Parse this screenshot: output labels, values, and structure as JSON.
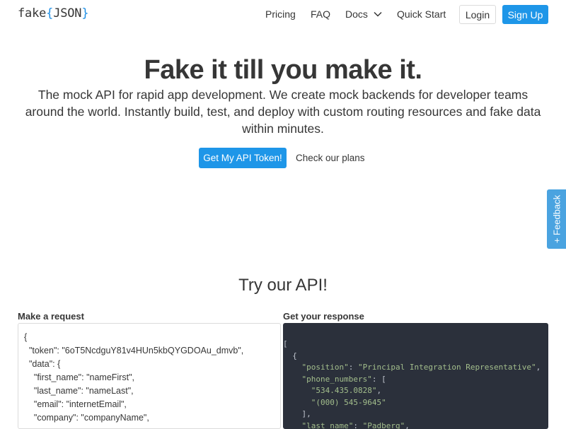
{
  "nav": {
    "logo_prefix": "fake",
    "logo_open": "{",
    "logo_word": "JSON",
    "logo_close": "}",
    "links": [
      "Pricing",
      "FAQ",
      "Docs",
      "Quick Start"
    ],
    "login_label": "Login",
    "signup_label": "Sign Up"
  },
  "hero": {
    "title": "Fake it till you make it.",
    "subtitle": "The mock API for rapid app development. We create mock backends for developer teams around the world. Instantly build, test, and deploy with custom routing resources and fake data within minutes.",
    "primary_cta": "Get My API Token!",
    "secondary_cta": "Check our plans"
  },
  "feedback": {
    "label": "+ Feedback"
  },
  "try_api": {
    "title": "Try our API!",
    "request_label": "Make a request",
    "response_label": "Get your response",
    "request_lines": [
      "{",
      "  \"token\": \"6oT5NcdguY81v4HUn5kbQYGDOAu_dmvb\",",
      "  \"data\": {",
      "    \"first_name\": \"nameFirst\",",
      "    \"last_name\": \"nameLast\",",
      "    \"email\": \"internetEmail\",",
      "    \"company\": \"companyName\","
    ],
    "response_lines": [
      "[",
      "  {",
      "    \"position\": \"Principal Integration Representative\",",
      "    \"phone_numbers\": [",
      "      \"534.435.0828\",",
      "      \"(000) 545-9645\"",
      "    ],",
      "    \"last_name\": \"Padberg\","
    ]
  },
  "colors": {
    "accent": "#1e96e8",
    "code_bg": "#2b303b",
    "code_string": "#a3be8c"
  }
}
